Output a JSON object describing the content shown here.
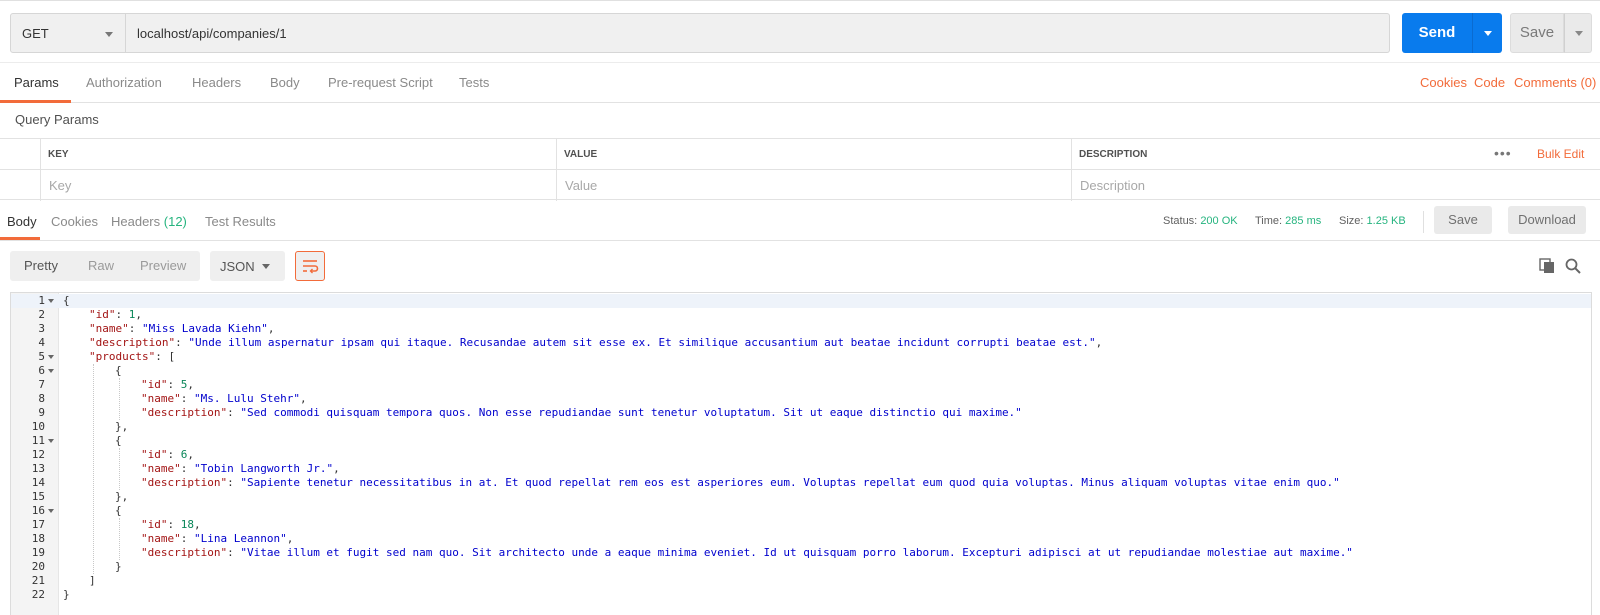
{
  "request": {
    "method": "GET",
    "url": "localhost/api/companies/1",
    "send_label": "Send",
    "save_label": "Save"
  },
  "request_tabs": [
    {
      "label": "Params",
      "active": true
    },
    {
      "label": "Authorization"
    },
    {
      "label": "Headers"
    },
    {
      "label": "Body"
    },
    {
      "label": "Pre-request Script"
    },
    {
      "label": "Tests"
    }
  ],
  "request_links": {
    "cookies": "Cookies",
    "code": "Code",
    "comments": "Comments (0)"
  },
  "query_params": {
    "title": "Query Params",
    "headers": {
      "key": "KEY",
      "value": "VALUE",
      "description": "DESCRIPTION"
    },
    "placeholders": {
      "key": "Key",
      "value": "Value",
      "description": "Description"
    },
    "bulk_edit": "Bulk Edit",
    "more": "•••"
  },
  "response_tabs": [
    {
      "label": "Body",
      "active": true
    },
    {
      "label": "Cookies"
    },
    {
      "label": "Headers",
      "count": "(12)"
    },
    {
      "label": "Test Results"
    }
  ],
  "response_status": {
    "status_label": "Status:",
    "status_value": "200 OK",
    "time_label": "Time:",
    "time_value": "285 ms",
    "size_label": "Size:",
    "size_value": "1.25 KB",
    "save_label": "Save",
    "download_label": "Download"
  },
  "view": {
    "modes": [
      "Pretty",
      "Raw",
      "Preview"
    ],
    "active_mode": "Pretty",
    "format": "JSON"
  },
  "colors": {
    "accent": "#f26b3a",
    "primary": "#097bed",
    "success": "#26b47f"
  },
  "code_lines": [
    {
      "n": "1",
      "fold": true,
      "indent": 0,
      "parts": [
        [
          "p",
          "{"
        ]
      ]
    },
    {
      "n": "2",
      "indent": 1,
      "parts": [
        [
          "k",
          "\"id\""
        ],
        [
          "p",
          ": "
        ],
        [
          "n",
          "1"
        ],
        [
          "p",
          ","
        ]
      ]
    },
    {
      "n": "3",
      "indent": 1,
      "parts": [
        [
          "k",
          "\"name\""
        ],
        [
          "p",
          ": "
        ],
        [
          "s",
          "\"Miss Lavada Kiehn\""
        ],
        [
          "p",
          ","
        ]
      ]
    },
    {
      "n": "4",
      "indent": 1,
      "parts": [
        [
          "k",
          "\"description\""
        ],
        [
          "p",
          ": "
        ],
        [
          "s",
          "\"Unde illum aspernatur ipsam qui itaque. Recusandae autem sit esse ex. Et similique accusantium aut beatae incidunt corrupti beatae est.\""
        ],
        [
          "p",
          ","
        ]
      ]
    },
    {
      "n": "5",
      "fold": true,
      "indent": 1,
      "parts": [
        [
          "k",
          "\"products\""
        ],
        [
          "p",
          ": ["
        ]
      ]
    },
    {
      "n": "6",
      "fold": true,
      "indent": 2,
      "parts": [
        [
          "p",
          "{"
        ]
      ]
    },
    {
      "n": "7",
      "indent": 3,
      "parts": [
        [
          "k",
          "\"id\""
        ],
        [
          "p",
          ": "
        ],
        [
          "n",
          "5"
        ],
        [
          "p",
          ","
        ]
      ]
    },
    {
      "n": "8",
      "indent": 3,
      "parts": [
        [
          "k",
          "\"name\""
        ],
        [
          "p",
          ": "
        ],
        [
          "s",
          "\"Ms. Lulu Stehr\""
        ],
        [
          "p",
          ","
        ]
      ]
    },
    {
      "n": "9",
      "indent": 3,
      "parts": [
        [
          "k",
          "\"description\""
        ],
        [
          "p",
          ": "
        ],
        [
          "s",
          "\"Sed commodi quisquam tempora quos. Non esse repudiandae sunt tenetur voluptatum. Sit ut eaque distinctio qui maxime.\""
        ]
      ]
    },
    {
      "n": "10",
      "indent": 2,
      "parts": [
        [
          "p",
          "},"
        ]
      ]
    },
    {
      "n": "11",
      "fold": true,
      "indent": 2,
      "parts": [
        [
          "p",
          "{"
        ]
      ]
    },
    {
      "n": "12",
      "indent": 3,
      "parts": [
        [
          "k",
          "\"id\""
        ],
        [
          "p",
          ": "
        ],
        [
          "n",
          "6"
        ],
        [
          "p",
          ","
        ]
      ]
    },
    {
      "n": "13",
      "indent": 3,
      "parts": [
        [
          "k",
          "\"name\""
        ],
        [
          "p",
          ": "
        ],
        [
          "s",
          "\"Tobin Langworth Jr.\""
        ],
        [
          "p",
          ","
        ]
      ]
    },
    {
      "n": "14",
      "indent": 3,
      "parts": [
        [
          "k",
          "\"description\""
        ],
        [
          "p",
          ": "
        ],
        [
          "s",
          "\"Sapiente tenetur necessitatibus in at. Et quod repellat rem eos est asperiores eum. Voluptas repellat eum quod quia voluptas. Minus aliquam voluptas vitae enim quo.\""
        ]
      ]
    },
    {
      "n": "15",
      "indent": 2,
      "parts": [
        [
          "p",
          "},"
        ]
      ]
    },
    {
      "n": "16",
      "fold": true,
      "indent": 2,
      "parts": [
        [
          "p",
          "{"
        ]
      ]
    },
    {
      "n": "17",
      "indent": 3,
      "parts": [
        [
          "k",
          "\"id\""
        ],
        [
          "p",
          ": "
        ],
        [
          "n",
          "18"
        ],
        [
          "p",
          ","
        ]
      ]
    },
    {
      "n": "18",
      "indent": 3,
      "parts": [
        [
          "k",
          "\"name\""
        ],
        [
          "p",
          ": "
        ],
        [
          "s",
          "\"Lina Leannon\""
        ],
        [
          "p",
          ","
        ]
      ]
    },
    {
      "n": "19",
      "indent": 3,
      "parts": [
        [
          "k",
          "\"description\""
        ],
        [
          "p",
          ": "
        ],
        [
          "s",
          "\"Vitae illum et fugit sed nam quo. Sit architecto unde a eaque minima eveniet. Id ut quisquam porro laborum. Excepturi adipisci at ut repudiandae molestiae aut maxime.\""
        ]
      ]
    },
    {
      "n": "20",
      "indent": 2,
      "parts": [
        [
          "p",
          "}"
        ]
      ]
    },
    {
      "n": "21",
      "indent": 1,
      "parts": [
        [
          "p",
          "]"
        ]
      ]
    },
    {
      "n": "22",
      "indent": 0,
      "parts": [
        [
          "p",
          "}"
        ]
      ]
    }
  ]
}
